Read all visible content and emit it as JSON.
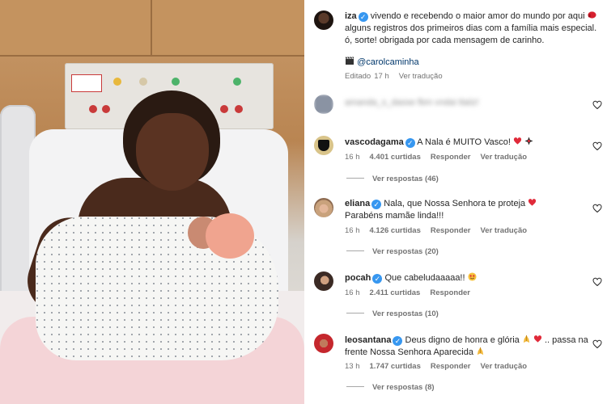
{
  "post": {
    "author": "iza",
    "caption_lines": [
      "vivendo e recebendo o maior amor do mundo por aqui",
      "alguns registros dos primeiros dias com a família mais especial.",
      "ó, sorte! obrigada por cada mensagem de carinho."
    ],
    "credit": "@carolcaminha",
    "edited": "Editado",
    "time": "17 h",
    "translate": "Ver tradução"
  },
  "blurred_comment": "amanda_s_dasse fbm vndai tlaiiz!",
  "comments": [
    {
      "user": "vascodagama",
      "text": "A Nala é MUITO Vasco!",
      "time": "16 h",
      "likes": "4.401 curtidas",
      "reply": "Responder",
      "translate": "Ver tradução",
      "replies": "Ver respostas (46)"
    },
    {
      "user": "eliana",
      "text": "Nala, que Nossa Senhora te proteja",
      "text2": "Parabéns mamãe linda!!!",
      "time": "16 h",
      "likes": "4.126 curtidas",
      "reply": "Responder",
      "translate": "Ver tradução",
      "replies": "Ver respostas (20)"
    },
    {
      "user": "pocah",
      "text": "Que cabeludaaaaa!!",
      "time": "16 h",
      "likes": "2.411 curtidas",
      "reply": "Responder",
      "replies": "Ver respostas (10)"
    },
    {
      "user": "leosantana",
      "text": "Deus digno de honra e glória",
      "text_after": ".. passa na",
      "text2": "frente Nossa Senhora Aparecida",
      "time": "13 h",
      "likes": "1.747 curtidas",
      "reply": "Responder",
      "translate": "Ver tradução",
      "replies": "Ver respostas (8)"
    }
  ],
  "icons": {
    "verified": "verified-badge-icon",
    "like": "heart-outline-icon",
    "clapper": "clapperboard-icon"
  },
  "colors": {
    "verified": "#3797f0",
    "secondary_text": "#737373",
    "red_heart": "#e02a3a"
  }
}
